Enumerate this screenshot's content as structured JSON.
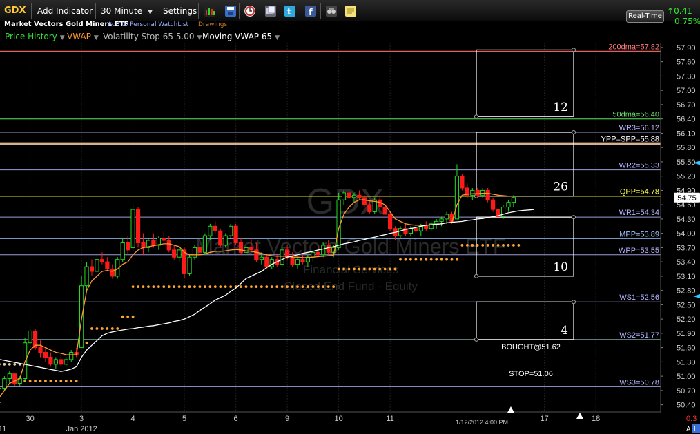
{
  "toolbar": {
    "symbol": "GDX",
    "add_indicator": "Add Indicator",
    "interval": "30 Minute",
    "settings": "Settings",
    "realtime": "Real-Time",
    "change": "0.41",
    "change_pct": "0.75%"
  },
  "header": {
    "security_name": "Market Vectors Gold Miners ETF",
    "add_watchlist": "Add to Personal WatchList",
    "drawings": "Drawings"
  },
  "indicators": [
    {
      "label": "Price History",
      "color": "#33dd33"
    },
    {
      "label": "VWAP",
      "color": "#ff9933"
    },
    {
      "label": "Volatility Stop 65 5.00",
      "color": "#bbbbbb"
    },
    {
      "label": "Moving VWAP 65",
      "color": "#ffffff"
    }
  ],
  "watermark": {
    "symbol": "GDX",
    "name": "Market Vectors Gold Miners ETF",
    "sector": "Financial Services",
    "industry": "Closed End Fund - Equity"
  },
  "chart_data": {
    "type": "candlestick",
    "symbol": "GDX",
    "interval": "30 Minute",
    "ylim": [
      50.25,
      58.0
    ],
    "y_ticks": [
      "57.90",
      "57.60",
      "57.30",
      "57.00",
      "56.70",
      "56.40",
      "56.10",
      "55.80",
      "55.50",
      "55.20",
      "54.90",
      "54.60",
      "54.30",
      "54.00",
      "53.70",
      "53.40",
      "53.10",
      "52.80",
      "52.50",
      "52.20",
      "51.90",
      "51.60",
      "51.30",
      "51.00",
      "50.70",
      "50.40"
    ],
    "x_ticks": [
      {
        "label": "30",
        "bar": 8
      },
      {
        "label": "3",
        "bar": 18
      },
      {
        "label": "4",
        "bar": 28
      },
      {
        "label": "5",
        "bar": 38
      },
      {
        "label": "6",
        "bar": 48
      },
      {
        "label": "9",
        "bar": 58
      },
      {
        "label": "10",
        "bar": 68
      },
      {
        "label": "11",
        "bar": 78
      },
      {
        "label": "17",
        "bar": 108
      },
      {
        "label": "18",
        "bar": 118
      }
    ],
    "x_sub_labels": [
      {
        "label": "2011",
        "bar": 1
      },
      {
        "label": "Jan 2012",
        "bar": 18
      }
    ],
    "cursor_time": "1/12/2012 4:00 PM",
    "last_price": "54.75",
    "corner_value": "0.3",
    "corner_buttons": [
      "A",
      "L"
    ],
    "candles": [
      {
        "o": 50.4,
        "h": 50.55,
        "l": 50.3,
        "c": 50.5
      },
      {
        "o": 50.5,
        "h": 50.6,
        "l": 50.38,
        "c": 50.45
      },
      {
        "o": 50.45,
        "h": 50.8,
        "l": 50.4,
        "c": 50.75
      },
      {
        "o": 50.75,
        "h": 51.0,
        "l": 50.7,
        "c": 50.95
      },
      {
        "o": 50.95,
        "h": 51.1,
        "l": 50.85,
        "c": 51.05
      },
      {
        "o": 51.05,
        "h": 51.0,
        "l": 50.8,
        "c": 50.85
      },
      {
        "o": 50.85,
        "h": 51.0,
        "l": 50.8,
        "c": 50.95
      },
      {
        "o": 50.95,
        "h": 51.8,
        "l": 50.9,
        "c": 51.7
      },
      {
        "o": 51.7,
        "h": 52.05,
        "l": 51.6,
        "c": 51.95
      },
      {
        "o": 51.95,
        "h": 52.0,
        "l": 51.55,
        "c": 51.6
      },
      {
        "o": 51.6,
        "h": 51.75,
        "l": 51.4,
        "c": 51.5
      },
      {
        "o": 51.5,
        "h": 51.6,
        "l": 51.3,
        "c": 51.4
      },
      {
        "o": 51.4,
        "h": 51.5,
        "l": 51.2,
        "c": 51.25
      },
      {
        "o": 51.25,
        "h": 51.4,
        "l": 51.15,
        "c": 51.35
      },
      {
        "o": 51.35,
        "h": 51.45,
        "l": 51.2,
        "c": 51.25
      },
      {
        "o": 51.25,
        "h": 51.4,
        "l": 51.2,
        "c": 51.35
      },
      {
        "o": 51.35,
        "h": 51.55,
        "l": 51.3,
        "c": 51.5
      },
      {
        "o": 51.5,
        "h": 51.6,
        "l": 51.4,
        "c": 51.45
      },
      {
        "o": 51.6,
        "h": 53.1,
        "l": 51.6,
        "c": 52.9
      },
      {
        "o": 52.9,
        "h": 53.4,
        "l": 52.8,
        "c": 53.3
      },
      {
        "o": 53.3,
        "h": 53.45,
        "l": 53.1,
        "c": 53.2
      },
      {
        "o": 53.2,
        "h": 53.55,
        "l": 53.15,
        "c": 53.45
      },
      {
        "o": 53.45,
        "h": 53.6,
        "l": 53.35,
        "c": 53.4
      },
      {
        "o": 53.4,
        "h": 53.5,
        "l": 53.2,
        "c": 53.25
      },
      {
        "o": 53.25,
        "h": 53.35,
        "l": 53.05,
        "c": 53.1
      },
      {
        "o": 53.1,
        "h": 53.5,
        "l": 53.05,
        "c": 53.45
      },
      {
        "o": 53.45,
        "h": 53.9,
        "l": 53.4,
        "c": 53.8
      },
      {
        "o": 53.8,
        "h": 53.95,
        "l": 53.55,
        "c": 53.65
      },
      {
        "o": 53.7,
        "h": 54.6,
        "l": 53.65,
        "c": 54.5
      },
      {
        "o": 54.5,
        "h": 54.55,
        "l": 53.7,
        "c": 53.8
      },
      {
        "o": 53.8,
        "h": 54.0,
        "l": 53.55,
        "c": 53.7
      },
      {
        "o": 53.7,
        "h": 53.9,
        "l": 53.6,
        "c": 53.85
      },
      {
        "o": 53.85,
        "h": 54.0,
        "l": 53.7,
        "c": 53.75
      },
      {
        "o": 53.75,
        "h": 53.95,
        "l": 53.65,
        "c": 53.9
      },
      {
        "o": 53.9,
        "h": 54.05,
        "l": 53.8,
        "c": 53.85
      },
      {
        "o": 53.85,
        "h": 53.95,
        "l": 53.6,
        "c": 53.65
      },
      {
        "o": 53.65,
        "h": 53.75,
        "l": 53.45,
        "c": 53.5
      },
      {
        "o": 53.5,
        "h": 53.7,
        "l": 53.4,
        "c": 53.65
      },
      {
        "o": 53.65,
        "h": 53.7,
        "l": 53.05,
        "c": 53.15
      },
      {
        "o": 53.15,
        "h": 53.55,
        "l": 53.1,
        "c": 53.5
      },
      {
        "o": 53.5,
        "h": 53.75,
        "l": 53.45,
        "c": 53.7
      },
      {
        "o": 53.7,
        "h": 53.85,
        "l": 53.55,
        "c": 53.6
      },
      {
        "o": 53.6,
        "h": 54.0,
        "l": 53.55,
        "c": 53.95
      },
      {
        "o": 53.95,
        "h": 54.2,
        "l": 53.85,
        "c": 54.15
      },
      {
        "o": 54.15,
        "h": 54.25,
        "l": 54.0,
        "c": 54.05
      },
      {
        "o": 54.05,
        "h": 54.1,
        "l": 53.7,
        "c": 53.75
      },
      {
        "o": 53.75,
        "h": 54.0,
        "l": 53.7,
        "c": 53.95
      },
      {
        "o": 53.95,
        "h": 54.2,
        "l": 53.9,
        "c": 54.15
      },
      {
        "o": 54.15,
        "h": 54.2,
        "l": 53.75,
        "c": 53.8
      },
      {
        "o": 53.8,
        "h": 53.9,
        "l": 53.55,
        "c": 53.6
      },
      {
        "o": 53.6,
        "h": 53.75,
        "l": 53.45,
        "c": 53.7
      },
      {
        "o": 53.7,
        "h": 53.9,
        "l": 53.6,
        "c": 53.65
      },
      {
        "o": 53.65,
        "h": 53.8,
        "l": 53.4,
        "c": 53.45
      },
      {
        "o": 53.45,
        "h": 53.6,
        "l": 53.35,
        "c": 53.5
      },
      {
        "o": 53.5,
        "h": 53.55,
        "l": 53.25,
        "c": 53.3
      },
      {
        "o": 53.3,
        "h": 53.5,
        "l": 53.25,
        "c": 53.45
      },
      {
        "o": 53.45,
        "h": 53.55,
        "l": 53.3,
        "c": 53.35
      },
      {
        "o": 53.35,
        "h": 53.7,
        "l": 53.3,
        "c": 53.65
      },
      {
        "o": 53.65,
        "h": 53.75,
        "l": 53.45,
        "c": 53.5
      },
      {
        "o": 53.5,
        "h": 53.6,
        "l": 53.3,
        "c": 53.35
      },
      {
        "o": 53.35,
        "h": 53.5,
        "l": 53.25,
        "c": 53.45
      },
      {
        "o": 53.45,
        "h": 53.55,
        "l": 53.35,
        "c": 53.4
      },
      {
        "o": 53.4,
        "h": 53.55,
        "l": 53.3,
        "c": 53.5
      },
      {
        "o": 53.5,
        "h": 53.65,
        "l": 53.4,
        "c": 53.6
      },
      {
        "o": 53.6,
        "h": 53.75,
        "l": 53.5,
        "c": 53.55
      },
      {
        "o": 53.55,
        "h": 53.8,
        "l": 53.5,
        "c": 53.75
      },
      {
        "o": 53.75,
        "h": 53.85,
        "l": 53.55,
        "c": 53.6
      },
      {
        "o": 53.6,
        "h": 53.75,
        "l": 53.5,
        "c": 53.7
      },
      {
        "o": 53.7,
        "h": 54.85,
        "l": 53.65,
        "c": 54.7
      },
      {
        "o": 54.7,
        "h": 54.9,
        "l": 54.6,
        "c": 54.85
      },
      {
        "o": 54.85,
        "h": 54.9,
        "l": 54.7,
        "c": 54.75
      },
      {
        "o": 54.75,
        "h": 54.85,
        "l": 54.65,
        "c": 54.8
      },
      {
        "o": 54.8,
        "h": 54.9,
        "l": 54.7,
        "c": 54.75
      },
      {
        "o": 54.75,
        "h": 54.8,
        "l": 54.55,
        "c": 54.6
      },
      {
        "o": 54.6,
        "h": 54.7,
        "l": 54.4,
        "c": 54.45
      },
      {
        "o": 54.45,
        "h": 54.75,
        "l": 54.4,
        "c": 54.7
      },
      {
        "o": 54.7,
        "h": 54.8,
        "l": 54.5,
        "c": 54.55
      },
      {
        "o": 54.55,
        "h": 54.6,
        "l": 54.35,
        "c": 54.4
      },
      {
        "o": 54.4,
        "h": 54.45,
        "l": 54.05,
        "c": 54.1
      },
      {
        "o": 54.1,
        "h": 54.15,
        "l": 53.85,
        "c": 53.95
      },
      {
        "o": 53.95,
        "h": 54.15,
        "l": 53.9,
        "c": 54.1
      },
      {
        "o": 54.1,
        "h": 54.2,
        "l": 53.95,
        "c": 54.0
      },
      {
        "o": 54.0,
        "h": 54.15,
        "l": 53.95,
        "c": 54.1
      },
      {
        "o": 54.1,
        "h": 54.2,
        "l": 54.0,
        "c": 54.05
      },
      {
        "o": 54.05,
        "h": 54.2,
        "l": 53.95,
        "c": 54.15
      },
      {
        "o": 54.15,
        "h": 54.25,
        "l": 54.05,
        "c": 54.1
      },
      {
        "o": 54.1,
        "h": 54.25,
        "l": 54.05,
        "c": 54.2
      },
      {
        "o": 54.2,
        "h": 54.3,
        "l": 54.1,
        "c": 54.25
      },
      {
        "o": 54.25,
        "h": 54.35,
        "l": 54.15,
        "c": 54.3
      },
      {
        "o": 54.3,
        "h": 54.45,
        "l": 54.2,
        "c": 54.4
      },
      {
        "o": 54.4,
        "h": 54.45,
        "l": 54.2,
        "c": 54.25
      },
      {
        "o": 54.3,
        "h": 55.45,
        "l": 54.3,
        "c": 55.2
      },
      {
        "o": 55.2,
        "h": 55.25,
        "l": 54.9,
        "c": 54.95
      },
      {
        "o": 54.95,
        "h": 55.05,
        "l": 54.75,
        "c": 54.8
      },
      {
        "o": 54.8,
        "h": 54.95,
        "l": 54.7,
        "c": 54.9
      },
      {
        "o": 54.9,
        "h": 54.95,
        "l": 54.75,
        "c": 54.8
      },
      {
        "o": 54.8,
        "h": 54.95,
        "l": 54.75,
        "c": 54.9
      },
      {
        "o": 54.9,
        "h": 54.95,
        "l": 54.65,
        "c": 54.7
      },
      {
        "o": 54.7,
        "h": 54.75,
        "l": 54.45,
        "c": 54.5
      },
      {
        "o": 54.5,
        "h": 54.55,
        "l": 54.3,
        "c": 54.35
      },
      {
        "o": 54.35,
        "h": 54.6,
        "l": 54.3,
        "c": 54.55
      },
      {
        "o": 54.55,
        "h": 54.7,
        "l": 54.45,
        "c": 54.65
      },
      {
        "o": 54.65,
        "h": 54.8,
        "l": 54.55,
        "c": 54.75
      }
    ],
    "vwap": [
      50.4,
      50.45,
      50.55,
      50.7,
      50.85,
      50.9,
      50.95,
      51.3,
      51.55,
      51.65,
      51.65,
      51.6,
      51.55,
      51.5,
      51.48,
      51.45,
      51.45,
      51.45,
      52.2,
      52.8,
      53.0,
      53.1,
      53.2,
      53.22,
      53.2,
      53.25,
      53.35,
      53.4,
      53.55,
      53.65,
      53.7,
      53.72,
      53.74,
      53.76,
      53.78,
      53.78,
      53.75,
      53.72,
      53.6,
      53.55,
      53.55,
      53.55,
      53.57,
      53.6,
      53.62,
      53.62,
      53.63,
      53.65,
      53.66,
      53.65,
      53.63,
      53.62,
      53.6,
      53.58,
      53.55,
      53.53,
      53.52,
      53.52,
      53.52,
      53.5,
      53.5,
      53.49,
      53.49,
      53.5,
      53.51,
      53.52,
      53.53,
      53.54,
      54.1,
      54.4,
      54.55,
      54.65,
      54.7,
      54.7,
      54.68,
      54.67,
      54.65,
      54.6,
      54.45,
      54.3,
      54.25,
      54.2,
      54.18,
      54.17,
      54.17,
      54.17,
      54.18,
      54.19,
      54.2,
      54.22,
      54.22,
      54.6,
      54.8,
      54.82,
      54.83,
      54.83,
      54.84,
      54.84,
      54.82,
      54.8,
      54.79,
      54.78,
      54.78
    ],
    "moving_vwap": {
      "start_bar": 14,
      "values": [
        51.1,
        51.12,
        51.15,
        51.2,
        51.4,
        51.55,
        51.65,
        51.75,
        51.85,
        51.9,
        51.93,
        51.95,
        51.97,
        51.99,
        52.0,
        52.02,
        52.03,
        52.05,
        52.06,
        52.08,
        52.1,
        52.12,
        52.15,
        52.17,
        52.2,
        52.25,
        52.3,
        52.38,
        52.45,
        52.52,
        52.6,
        52.65,
        52.7,
        52.78,
        52.85,
        52.95,
        53.05,
        53.1,
        53.15,
        53.2,
        53.28,
        53.35,
        53.4,
        53.45,
        53.5,
        53.52,
        53.55,
        53.58,
        53.6,
        53.62,
        53.65,
        53.67,
        53.7,
        53.72,
        53.75,
        53.78,
        53.8,
        53.82,
        53.85,
        53.87,
        53.9,
        53.92,
        53.95,
        53.97,
        54.0,
        54.02,
        54.05,
        54.08,
        54.1,
        54.12,
        54.15,
        54.17,
        54.18,
        54.19,
        54.2,
        54.22,
        54.23,
        54.24,
        54.25,
        54.27,
        54.28,
        54.3,
        54.31,
        54.33,
        54.35,
        54.37,
        54.4,
        54.43,
        54.45,
        54.47,
        54.48,
        54.49,
        54.5
      ]
    },
    "volatility_stop": [
      {
        "from": 7,
        "to": 17,
        "value": 50.9
      },
      {
        "from": 18,
        "to": 19,
        "value": 51.7
      },
      {
        "from": 20,
        "to": 25,
        "value": 52.0
      },
      {
        "from": 26,
        "to": 28,
        "value": 52.25
      },
      {
        "from": 28,
        "to": 67,
        "value": 52.88
      },
      {
        "from": 68,
        "to": 79,
        "value": 53.25
      },
      {
        "from": 80,
        "to": 91,
        "value": 53.45
      },
      {
        "from": 92,
        "to": 103,
        "value": 53.75
      }
    ],
    "hlines": [
      {
        "label": "200dma=57.82",
        "value": 57.82,
        "color": "#ff7a7a",
        "line": "#e06060",
        "w": 1.5
      },
      {
        "label": "50dma=56.40",
        "value": 56.4,
        "color": "#66dd66",
        "line": "#44aa44",
        "w": 1.5
      },
      {
        "label": "WR3=56.12",
        "value": 56.12,
        "color": "#b4b4ff",
        "line": "#9c9cd8",
        "w": 1
      },
      {
        "label": "YPP=SPP=55.88",
        "value": 55.88,
        "color": "#ffffff",
        "line": "#d8b090",
        "w": 4
      },
      {
        "label": "WR2=55.33",
        "value": 55.33,
        "color": "#b4b4ff",
        "line": "#9c9cd8",
        "w": 1
      },
      {
        "label": "QPP=54.78",
        "value": 54.78,
        "color": "#ffff44",
        "line": "#d8d820",
        "w": 1.5
      },
      {
        "label": "WR1=54.34",
        "value": 54.34,
        "color": "#b4b4ff",
        "line": "#9c9cd8",
        "w": 1
      },
      {
        "label": "MPP=53.89",
        "value": 53.89,
        "color": "#9cc8ff",
        "line": "#9cc8ff",
        "w": 1
      },
      {
        "label": "WPP=53.55",
        "value": 53.55,
        "color": "#b4b4ff",
        "line": "#9c9cd8",
        "w": 1
      },
      {
        "label": "WS1=52.56",
        "value": 52.56,
        "color": "#b4b4ff",
        "line": "#9c9cd8",
        "w": 1
      },
      {
        "label": "WS2=51.77",
        "value": 51.77,
        "color": "#b4b4ff",
        "line": "#90c8c8",
        "w": 1
      },
      {
        "label": "WS3=50.78",
        "value": 50.78,
        "color": "#b4b4ff",
        "line": "#9c9cd8",
        "w": 1
      }
    ],
    "annotations": [
      {
        "text": "BOUGHT@51.62",
        "value": 51.62
      },
      {
        "text": "STOP=51.06",
        "value": 51.06
      }
    ],
    "boxes": [
      {
        "label": "12",
        "top": 57.85,
        "bottom": 56.45
      },
      {
        "label": "26",
        "top": 56.12,
        "bottom": 54.78
      },
      {
        "label": "10",
        "top": 54.34,
        "bottom": 53.1
      },
      {
        "label": "4",
        "top": 52.56,
        "bottom": 51.77
      }
    ],
    "colors": {
      "up": "#22dd22",
      "down": "#ff1a1a",
      "vwap": "#ff9933",
      "moving_vwap": "#ffffff",
      "volatility_stop": "#ffa533"
    }
  }
}
